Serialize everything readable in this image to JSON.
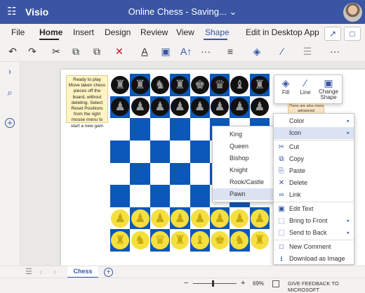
{
  "titlebar": {
    "app_name": "Visio",
    "doc_title": "Online Chess  -  Saving... ⌄"
  },
  "tabs": [
    "File",
    "Home",
    "Insert",
    "Design",
    "Review",
    "View",
    "Shape",
    "Edit in Desktop App"
  ],
  "active_tab": "Home",
  "icons": {
    "waffle": "☷",
    "share": "↗",
    "comment": "□",
    "undo": "↶",
    "redo": "↷",
    "cut": "✂",
    "paste": "⧉",
    "delete": "✕",
    "font_color": "A",
    "textbox": "▣",
    "font_size": "A↑",
    "more": "···",
    "align": "≡",
    "fill": "◈",
    "line": "∕",
    "arrange": "☰",
    "chevron_right": "›",
    "search": "⌕",
    "add": "+",
    "rook": "♜",
    "knight": "♞",
    "bishop": "♝",
    "queen": "♛",
    "king": "♚",
    "pawn": "♟"
  },
  "note_text": "Ready to play Move taken chess pieces off the board, without deleting. Select Reset Positions from the right mouse menu to start a new gam",
  "orange_note_text": "There are also more advanced",
  "floatbar": {
    "fill": "Fill",
    "line": "Line",
    "change_shape": "Change Shape"
  },
  "board": {
    "dark_square_color": "#0c58b8",
    "light_square_color": "#ffffff",
    "dark_piece_color": "#111111",
    "light_piece_color": "#f5e040",
    "rows": [
      [
        "rook",
        "rook",
        "knight",
        "rook",
        "king",
        "queen",
        "bishop",
        "rook"
      ],
      [
        "pawn",
        "pawn",
        "pawn",
        "pawn",
        "pawn",
        "pawn",
        "pawn",
        "pawn"
      ],
      [
        "",
        "",
        "",
        "",
        "",
        "",
        "",
        ""
      ],
      [
        "",
        "",
        "",
        "",
        "",
        "",
        "",
        ""
      ],
      [
        "",
        "",
        "",
        "",
        "",
        "",
        "",
        ""
      ],
      [
        "",
        "",
        "",
        "",
        "",
        "",
        "",
        ""
      ],
      [
        "pawn",
        "pawn",
        "pawn",
        "pawn",
        "pawn",
        "pawn",
        "pawn",
        "pawn"
      ],
      [
        "rook",
        "knight",
        "queen",
        "rook",
        "bishop",
        "king",
        "knight",
        "rook"
      ]
    ]
  },
  "submenu": {
    "items": [
      "King",
      "Queen",
      "Bishop",
      "Knight",
      "Rook/Castle",
      "Pawn"
    ],
    "highlighted": "Pawn"
  },
  "context_menu": {
    "items": [
      {
        "icon": "",
        "label": "Color",
        "arrow": "▸"
      },
      {
        "icon": "",
        "label": "Icon",
        "arrow": "▸"
      },
      {
        "icon": "✂",
        "label": "Cut",
        "arrow": ""
      },
      {
        "icon": "⧉",
        "label": "Copy",
        "arrow": ""
      },
      {
        "icon": "⎘",
        "label": "Paste",
        "arrow": ""
      },
      {
        "icon": "✕",
        "label": "Delete",
        "arrow": ""
      },
      {
        "icon": "∞",
        "label": "Link",
        "arrow": ""
      },
      {
        "icon": "▣",
        "label": "Edit Text",
        "arrow": ""
      },
      {
        "icon": "⬚",
        "label": "Bring to Front",
        "arrow": "▸"
      },
      {
        "icon": "⬚",
        "label": "Send to Back",
        "arrow": "▸"
      },
      {
        "icon": "□",
        "label": "New Comment",
        "arrow": ""
      },
      {
        "icon": "⭳",
        "label": "Download as Image",
        "arrow": ""
      }
    ],
    "highlighted": "Icon"
  },
  "page_tab": "Chess",
  "status": {
    "zoom_minus": "−",
    "zoom_plus": "+",
    "zoom": "69%",
    "feedback": "GIVE FEEDBACK TO MICROSOFT"
  }
}
